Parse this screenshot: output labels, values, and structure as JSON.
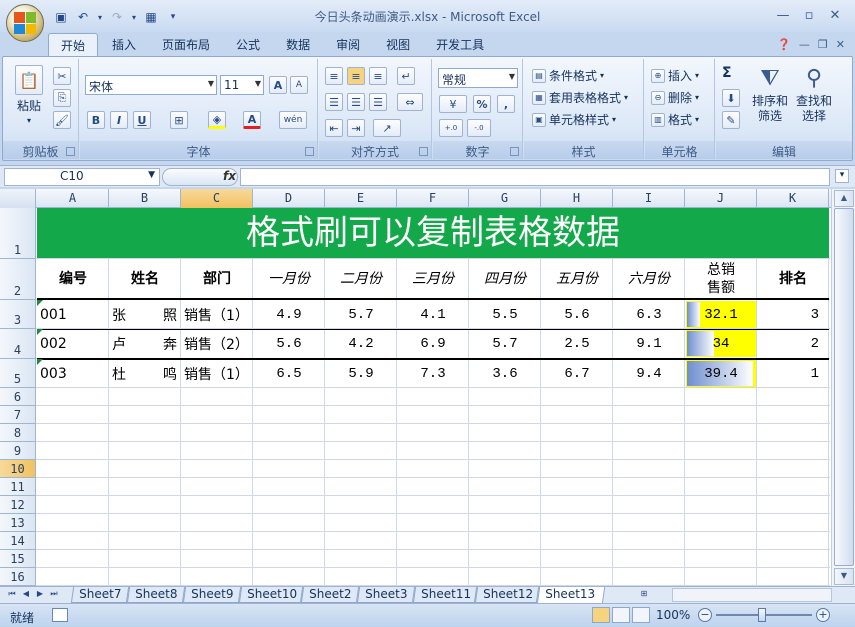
{
  "window": {
    "title": "今日头条动画演示.xlsx - Microsoft Excel"
  },
  "ribbon": {
    "tabs": [
      "开始",
      "插入",
      "页面布局",
      "公式",
      "数据",
      "审阅",
      "视图",
      "开发工具"
    ],
    "active_tab": "开始",
    "clipboard": {
      "paste_label": "粘贴",
      "group_label": "剪贴板"
    },
    "font": {
      "name": "宋体",
      "size": "11",
      "group_label": "字体",
      "bold": "B",
      "italic": "I",
      "underline": "U",
      "grow": "A",
      "shrink": "A",
      "font_color": "A",
      "phonetic": "wén"
    },
    "alignment": {
      "group_label": "对齐方式"
    },
    "number": {
      "format": "常规",
      "group_label": "数字",
      "percent": "%",
      "comma": ",",
      "inc_decimal": ".00→.0",
      "dec_decimal": ".0→.00"
    },
    "styles": {
      "conditional": "条件格式",
      "table": "套用表格格式",
      "cell": "单元格样式",
      "group_label": "样式"
    },
    "cells": {
      "insert": "插入",
      "delete": "删除",
      "format": "格式",
      "group_label": "单元格"
    },
    "editing": {
      "sort_filter": "排序和\n筛选",
      "sort_filter_l1": "排序和",
      "sort_filter_l2": "筛选",
      "find_l1": "查找和",
      "find_l2": "选择",
      "group_label": "编辑",
      "sum": "Σ"
    }
  },
  "formula_bar": {
    "name_box": "C10",
    "fx": "fx",
    "formula": ""
  },
  "columns": [
    "A",
    "B",
    "C",
    "D",
    "E",
    "F",
    "G",
    "H",
    "I",
    "J",
    "K"
  ],
  "rows": [
    "1",
    "2",
    "3",
    "4",
    "5",
    "6",
    "7",
    "8",
    "9",
    "10",
    "11",
    "12",
    "13",
    "14",
    "15",
    "16"
  ],
  "selected": {
    "column": "C",
    "row": "10"
  },
  "sheet": {
    "banner": "格式刷可以复制表格数据",
    "headers": {
      "id": "编号",
      "name": "姓名",
      "dept": "部门",
      "m1": "一月份",
      "m2": "二月份",
      "m3": "三月份",
      "m4": "四月份",
      "m5": "五月份",
      "m6": "六月份",
      "total_l1": "总销",
      "total_l2": "售额",
      "rank": "排名"
    },
    "records": [
      {
        "id": "001",
        "name_a": "张",
        "name_b": "照",
        "dept": "销售（1）",
        "m1": "4.9",
        "m2": "5.7",
        "m3": "4.1",
        "m4": "5.5",
        "m5": "5.6",
        "m6": "6.3",
        "total": "32.1",
        "total_value": 32.1,
        "rank": "3"
      },
      {
        "id": "002",
        "name_a": "卢",
        "name_b": "奔",
        "dept": "销售（2）",
        "m1": "5.6",
        "m2": "4.2",
        "m3": "6.9",
        "m4": "5.7",
        "m5": "2.5",
        "m6": "9.1",
        "total": "34",
        "total_value": 34,
        "rank": "2"
      },
      {
        "id": "003",
        "name_a": "杜",
        "name_b": "鸣",
        "dept": "销售（1）",
        "m1": "6.5",
        "m2": "5.9",
        "m3": "7.3",
        "m4": "3.6",
        "m5": "6.7",
        "m6": "9.4",
        "total": "39.4",
        "total_value": 39.4,
        "rank": "1"
      }
    ],
    "databar_min": 32.1,
    "databar_max": 39.4
  },
  "sheet_tabs": [
    "Sheet7",
    "Sheet8",
    "Sheet9",
    "Sheet10",
    "Sheet2",
    "Sheet3",
    "Sheet11",
    "Sheet12",
    "Sheet13"
  ],
  "active_sheet": "Sheet13",
  "status": {
    "ready": "就绪",
    "zoom": "100%"
  },
  "colors": {
    "banner": "#13a84a",
    "highlight": "#ffff00",
    "databar": "#6f8fd0",
    "selection": "#f1c15f"
  }
}
